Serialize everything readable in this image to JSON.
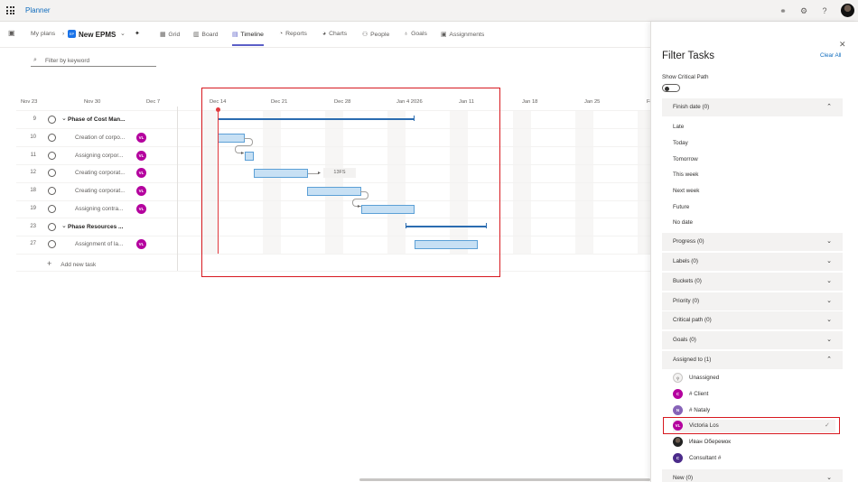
{
  "app": {
    "name": "Planner"
  },
  "top_icons": [
    "share-icon",
    "settings-icon",
    "help-icon"
  ],
  "plan": {
    "breadcrumb": "My plans",
    "badge_text": "EP",
    "title": "New EPMS",
    "tabs": [
      {
        "label": "Grid",
        "icon": "grid-icon"
      },
      {
        "label": "Board",
        "icon": "board-icon"
      },
      {
        "label": "Timeline",
        "icon": "timeline-icon",
        "active": true
      },
      {
        "label": "Reports",
        "icon": "reports-icon"
      },
      {
        "label": "Charts",
        "icon": "charts-icon"
      },
      {
        "label": "People",
        "icon": "people-icon"
      },
      {
        "label": "Goals",
        "icon": "goals-icon"
      },
      {
        "label": "Assignments",
        "icon": "assignments-icon"
      }
    ]
  },
  "filter": {
    "placeholder": "Filter by keyword"
  },
  "timeline": {
    "dates": [
      "Nov 23",
      "Nov 30",
      "Dec 7",
      "Dec 14",
      "Dec 21",
      "Dec 28",
      "Jan 4 2026",
      "Jan 11",
      "Jan 18",
      "Jan 25",
      "Fe"
    ],
    "tasks": [
      {
        "id": "9",
        "name": "Phase of Cost Man...",
        "phase": true
      },
      {
        "id": "10",
        "name": "Creation of corpo...",
        "assignee": "VL"
      },
      {
        "id": "11",
        "name": "Assigning corpor...",
        "assignee": "VL"
      },
      {
        "id": "12",
        "name": "Creating corporat...",
        "assignee": "VL"
      },
      {
        "id": "18",
        "name": "Creating corporat...",
        "assignee": "VL"
      },
      {
        "id": "19",
        "name": "Assigning contra...",
        "assignee": "VL"
      },
      {
        "id": "23",
        "name": "Phase Resources ...",
        "phase": true
      },
      {
        "id": "27",
        "name": "Assignment of la...",
        "assignee": "VL"
      }
    ],
    "lag_label": "13FS",
    "add_task": "Add new task"
  },
  "panel": {
    "title": "Filter Tasks",
    "clear_all": "Clear All",
    "critical_label": "Show Critical Path",
    "critical_on": false,
    "finish_date": {
      "label": "Finish date (0)",
      "options": [
        "Late",
        "Today",
        "Tomorrow",
        "This week",
        "Next week",
        "Future",
        "No date"
      ]
    },
    "sections": [
      "Progress (0)",
      "Labels (0)",
      "Buckets (0)",
      "Priority (0)",
      "Critical path (0)",
      "Goals (0)"
    ],
    "assigned": {
      "label": "Assigned to (1)",
      "people": [
        {
          "initials": "",
          "name": "Unassigned",
          "color": "#e1dfdd",
          "selected": false
        },
        {
          "initials": "C",
          "name": "# Client",
          "color": "#b4009e",
          "selected": false
        },
        {
          "initials": "N",
          "name": "# Nataly",
          "color": "#8764b8",
          "selected": false
        },
        {
          "initials": "VL",
          "name": "Victoria Los",
          "color": "#b4009e",
          "selected": true
        },
        {
          "initials": "",
          "name": "Иван Оберемок",
          "color": "#222222",
          "selected": false
        },
        {
          "initials": "C",
          "name": "Consultant #",
          "color": "#4b2b8a",
          "selected": false
        }
      ]
    },
    "new_section": "New (0)"
  }
}
